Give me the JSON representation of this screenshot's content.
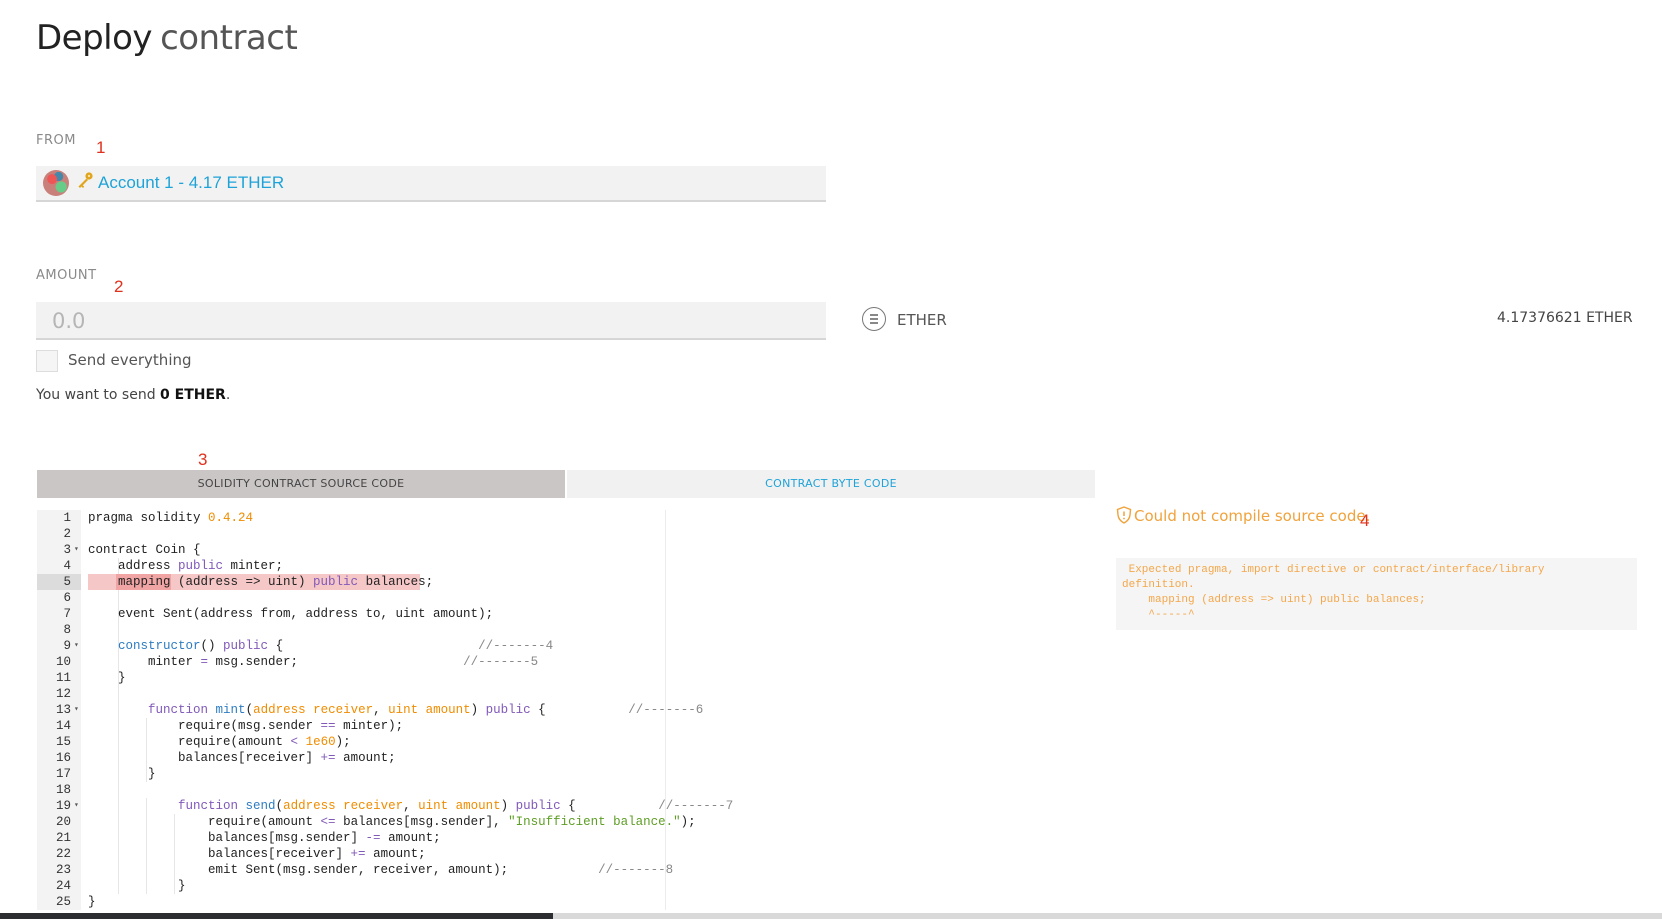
{
  "page": {
    "title_bold": "Deploy",
    "title_light": "contract"
  },
  "markers": [
    "1",
    "2",
    "3",
    "4"
  ],
  "from": {
    "label": "FROM",
    "account": "Account 1 - 4.17 ETHER",
    "icons": [
      "identicon-avatar",
      "key-icon"
    ]
  },
  "amount": {
    "label": "AMOUNT",
    "placeholder": "0.0",
    "value": "",
    "unit": "ETHER",
    "unit_icon": "ether-icon",
    "balance": "4.17376621 ETHER",
    "send_everything_label": "Send everything",
    "send_everything_checked": false,
    "summary_prefix": "You want to send ",
    "summary_value": "0 ETHER",
    "summary_suffix": "."
  },
  "tabs": [
    {
      "label": "SOLIDITY CONTRACT SOURCE CODE",
      "active": true
    },
    {
      "label": "CONTRACT BYTE CODE",
      "active": false
    }
  ],
  "editor": {
    "error_line": 5,
    "lines": [
      {
        "n": "1",
        "fold": false,
        "html": "pragma solidity <span class=\"k-num\">0.4.24</span>"
      },
      {
        "n": "2",
        "fold": false,
        "html": ""
      },
      {
        "n": "3",
        "fold": true,
        "html": "contract Coin {"
      },
      {
        "n": "4",
        "fold": false,
        "html": "    address <span class=\"k-kw\">public</span> minter;"
      },
      {
        "n": "5",
        "fold": false,
        "html": "    mapping (address =&gt; uint) <span class=\"k-kw\">public</span> balances;"
      },
      {
        "n": "6",
        "fold": false,
        "html": ""
      },
      {
        "n": "7",
        "fold": false,
        "html": "    event Sent(address from, address to, uint amount);"
      },
      {
        "n": "8",
        "fold": false,
        "html": ""
      },
      {
        "n": "9",
        "fold": true,
        "html": "    <span class=\"k-fn\">constructor</span>() <span class=\"k-kw\">public</span> {                          <span class=\"k-cmt\">//-------4</span>"
      },
      {
        "n": "10",
        "fold": false,
        "html": "        minter <span class=\"k-op\">=</span> msg.sender;                      <span class=\"k-cmt\">//-------5</span>"
      },
      {
        "n": "11",
        "fold": false,
        "html": "    }"
      },
      {
        "n": "12",
        "fold": false,
        "html": ""
      },
      {
        "n": "13",
        "fold": true,
        "html": "        <span class=\"k-kw\">function</span> <span class=\"k-fn\">mint</span>(<span class=\"k-arg\">address receiver</span>, <span class=\"k-arg\">uint amount</span>) <span class=\"k-kw\">public</span> {           <span class=\"k-cmt\">//-------6</span>"
      },
      {
        "n": "14",
        "fold": false,
        "html": "            require(msg.sender <span class=\"k-op\">==</span> minter);"
      },
      {
        "n": "15",
        "fold": false,
        "html": "            require(amount <span class=\"k-op\">&lt;</span> <span class=\"k-num\">1e60</span>);"
      },
      {
        "n": "16",
        "fold": false,
        "html": "            balances[receiver] <span class=\"k-op\">+=</span> amount;"
      },
      {
        "n": "17",
        "fold": false,
        "html": "        }"
      },
      {
        "n": "18",
        "fold": false,
        "html": ""
      },
      {
        "n": "19",
        "fold": true,
        "html": "            <span class=\"k-kw\">function</span> <span class=\"k-fn\">send</span>(<span class=\"k-arg\">address receiver</span>, <span class=\"k-arg\">uint amount</span>) <span class=\"k-kw\">public</span> {           <span class=\"k-cmt\">//-------7</span>"
      },
      {
        "n": "20",
        "fold": false,
        "html": "                require(amount <span class=\"k-op\">&lt;=</span> balances[msg.sender], <span class=\"k-str\">\"Insufficient balance.\"</span>);"
      },
      {
        "n": "21",
        "fold": false,
        "html": "                balances[msg.sender] <span class=\"k-op\">-=</span> amount;"
      },
      {
        "n": "22",
        "fold": false,
        "html": "                balances[receiver] <span class=\"k-op\">+=</span> amount;"
      },
      {
        "n": "23",
        "fold": false,
        "html": "                emit Sent(msg.sender, receiver, amount);            <span class=\"k-cmt\">//-------8</span>"
      },
      {
        "n": "24",
        "fold": false,
        "html": "            }"
      },
      {
        "n": "25",
        "fold": false,
        "html": "}"
      }
    ]
  },
  "compile": {
    "status": "Could not compile source code.",
    "status_icon": "shield-warning-icon",
    "error": " Expected pragma, import directive or contract/interface/library\ndefinition.\n    mapping (address => uint) public balances;\n    ^-----^"
  },
  "colors": {
    "accent": "#1ea3d8",
    "warning": "#f0a23b",
    "marker": "#e0311d",
    "error_highlight": "#f6c7c7"
  }
}
